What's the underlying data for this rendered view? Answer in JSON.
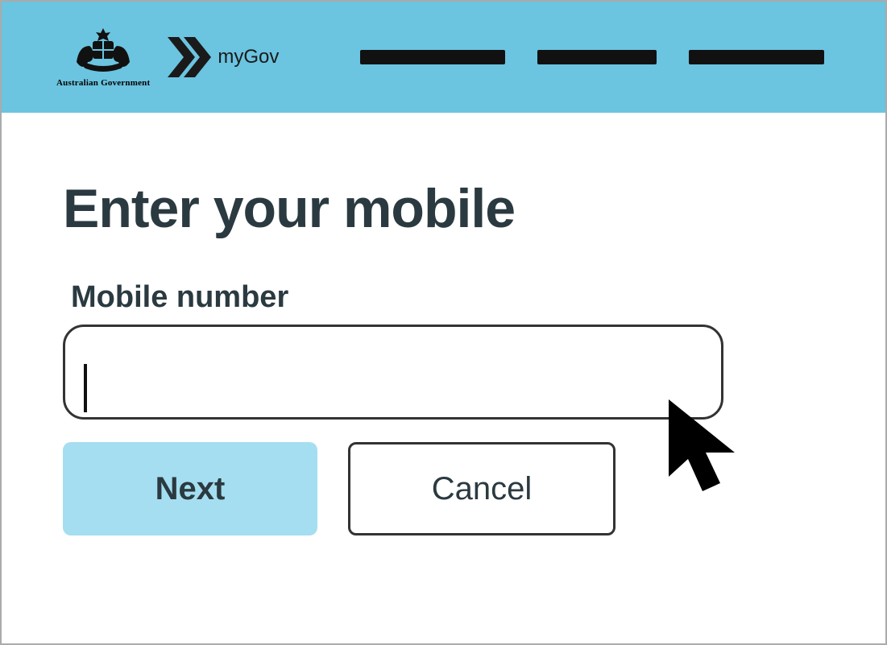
{
  "header": {
    "gov_label": "Australian Government",
    "mygov_label": "myGov"
  },
  "page": {
    "title": "Enter your mobile"
  },
  "form": {
    "mobile_label": "Mobile number",
    "mobile_value": ""
  },
  "buttons": {
    "next_label": "Next",
    "cancel_label": "Cancel"
  },
  "colors": {
    "header_bg": "#6bc4e0",
    "primary_button": "#a5def0",
    "text_dark": "#2a3a40"
  }
}
